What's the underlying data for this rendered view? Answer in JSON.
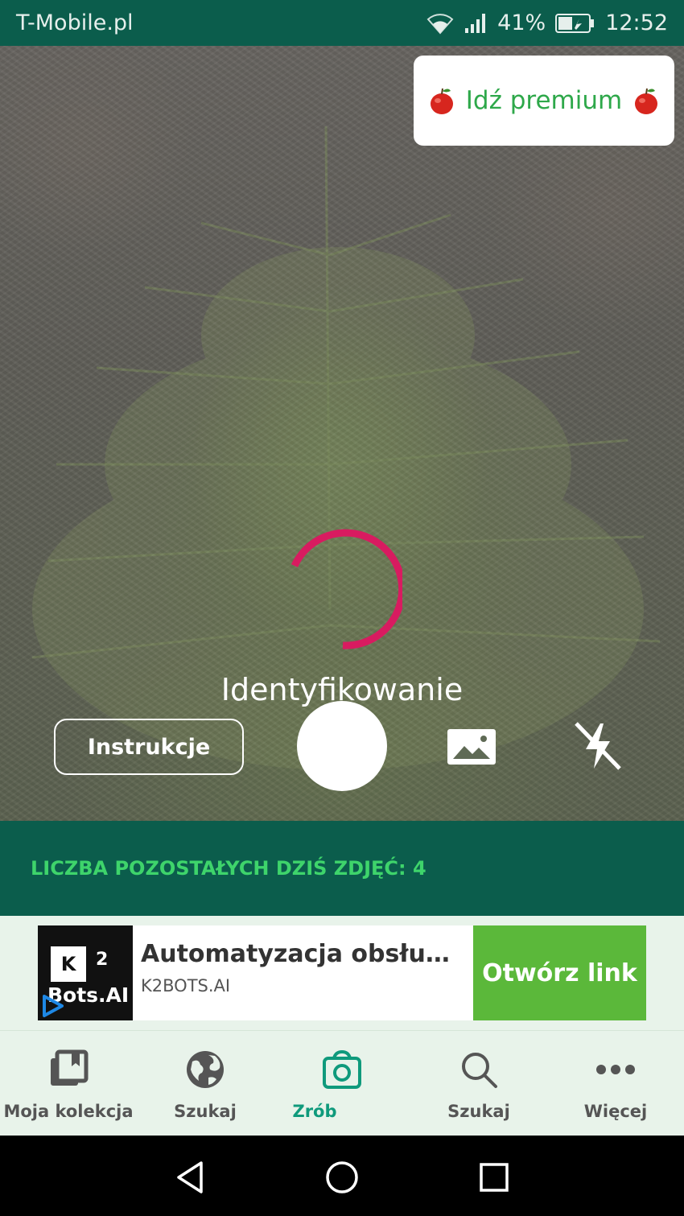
{
  "status_bar": {
    "carrier": "T-Mobile.pl",
    "battery": "41%",
    "time": "12:52"
  },
  "camera": {
    "premium_label": "Idź premium",
    "identifying_label": "Identyfikowanie",
    "instructions_label": "Instrukcje",
    "spinner_color": "#d81b60"
  },
  "remaining": {
    "text": "LICZBA POZOSTAŁYCH DZIŚ ZDJĘĆ: 4"
  },
  "ad": {
    "logo_k": "K",
    "logo_2": "2",
    "logo_bots": "Bots.AI",
    "title": "Automatyzacja obsługi kl...",
    "domain": "K2BOTS.AI",
    "cta": "Otwórz link"
  },
  "bottom_nav": {
    "items": [
      {
        "label": "Moja kolekcja",
        "icon": "collection-icon"
      },
      {
        "label": "Szukaj",
        "icon": "globe-icon"
      },
      {
        "label": "Zrób",
        "icon": "camera-icon",
        "active": true
      },
      {
        "label": "Szukaj",
        "icon": "search-icon"
      },
      {
        "label": "Więcej",
        "icon": "more-icon"
      }
    ]
  },
  "colors": {
    "header_green": "#0b5d4c",
    "accent_green": "#3ed46b",
    "active_nav": "#0f9a7c",
    "ad_cta": "#5bb83a"
  }
}
